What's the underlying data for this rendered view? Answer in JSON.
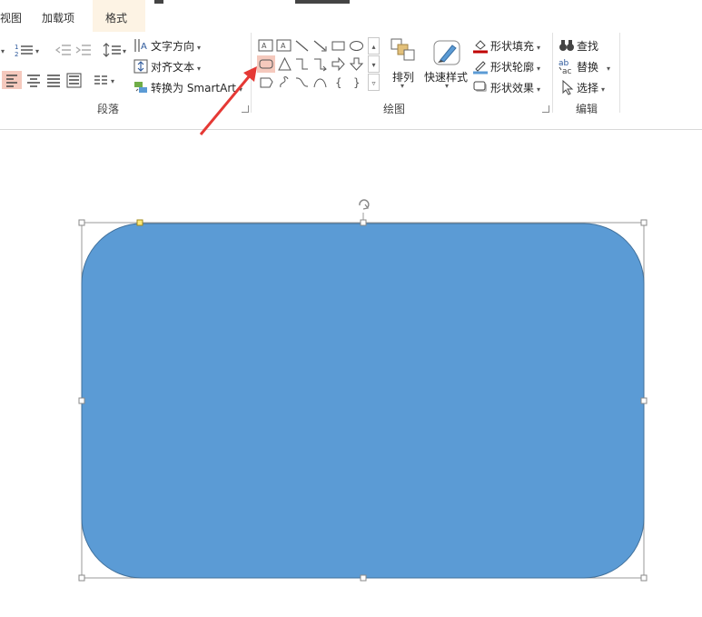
{
  "tabs": {
    "view": "视图",
    "addins": "加载项",
    "format": "格式"
  },
  "paragraph": {
    "text_direction": "文字方向",
    "align_text": "对齐文本",
    "convert_smartart": "转换为 SmartArt",
    "group_label": "段落"
  },
  "drawing": {
    "arrange": "排列",
    "quick_styles": "快速样式",
    "shape_fill": "形状填充",
    "shape_outline": "形状轮廓",
    "shape_effects": "形状效果",
    "group_label": "绘图"
  },
  "editing": {
    "find": "查找",
    "replace": "替换",
    "select": "选择",
    "group_label": "编辑"
  },
  "colors": {
    "shape_fill": "#5b9bd5",
    "shape_stroke": "#41719c",
    "arrow": "#e53935",
    "selected_shape_bg": "#f5c9bd",
    "active_tab_bg": "#fdf3e4"
  },
  "icons": {
    "find": "binoculars-icon",
    "replace": "replace-icon",
    "select": "cursor-icon",
    "fill": "paint-bucket-icon",
    "outline": "pen-icon",
    "effects": "effects-icon",
    "rotate": "rotate-handle-icon"
  }
}
